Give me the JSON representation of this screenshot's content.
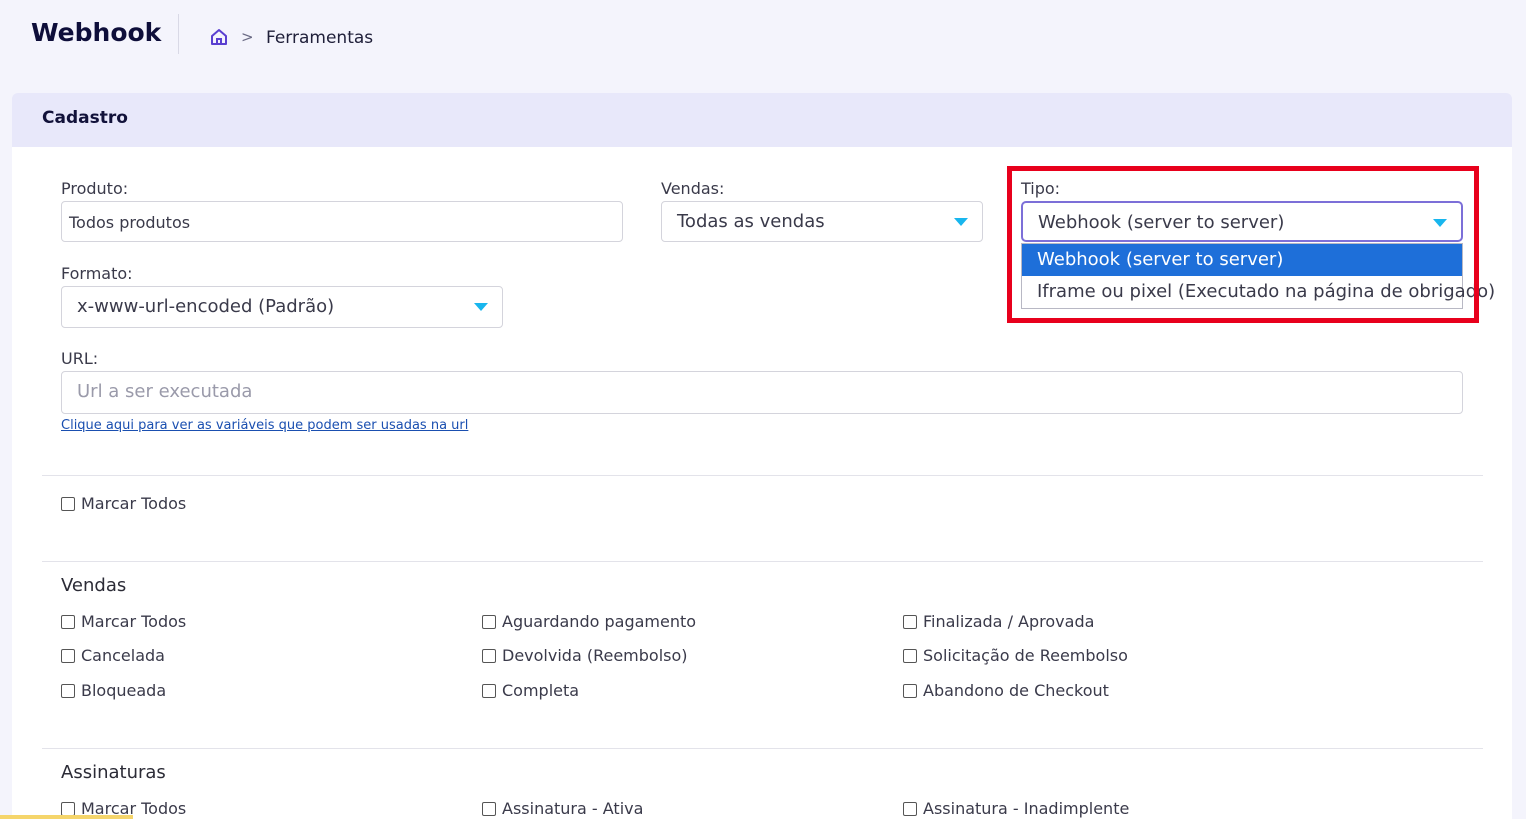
{
  "header": {
    "title": "Webhook",
    "breadcrumb_sep": ">",
    "breadcrumb_current": "Ferramentas"
  },
  "card": {
    "title": "Cadastro"
  },
  "form": {
    "produto": {
      "label": "Produto:",
      "value": "Todos produtos"
    },
    "vendas": {
      "label": "Vendas:",
      "value": "Todas as vendas"
    },
    "tipo": {
      "label": "Tipo:",
      "value": "Webhook (server to server)",
      "options": [
        "Webhook (server to server)",
        "Iframe ou pixel (Executado na página de obrigado)"
      ]
    },
    "formato": {
      "label": "Formato:",
      "value": "x-www-url-encoded (Padrão)"
    },
    "url": {
      "label": "URL:",
      "placeholder": "Url a ser executada",
      "help_link": "Clique aqui para ver as variáveis que podem ser usadas na url"
    }
  },
  "marcar_todos": "Marcar Todos",
  "vendas_section": {
    "title": "Vendas",
    "items": [
      "Marcar Todos",
      "Aguardando pagamento",
      "Finalizada / Aprovada",
      "Cancelada",
      "Devolvida (Reembolso)",
      "Solicitação de Reembolso",
      "Bloqueada",
      "Completa",
      "Abandono de Checkout"
    ]
  },
  "assinaturas_section": {
    "title": "Assinaturas",
    "items": [
      "Marcar Todos",
      "Assinatura - Ativa",
      "Assinatura - Inadimplente"
    ]
  },
  "colors": {
    "accent": "#18b6ee",
    "selected_option": "#1e6fd9",
    "highlight": "#e8001c"
  }
}
